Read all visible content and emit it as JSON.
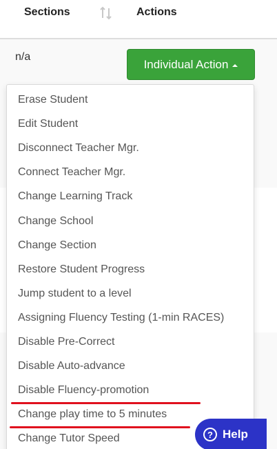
{
  "table": {
    "headers": {
      "sections": "Sections",
      "actions": "Actions"
    },
    "row": {
      "section_value": "n/a"
    }
  },
  "action_button": {
    "label": "Individual Action",
    "color": "#3aa33a",
    "state": "expanded"
  },
  "dropdown": {
    "items": [
      "Erase Student",
      "Edit Student",
      "Disconnect Teacher Mgr.",
      "Connect Teacher Mgr.",
      "Change Learning Track",
      "Change School",
      "Change Section",
      "Restore Student Progress",
      "Jump student to a level",
      "Assigning Fluency Testing (1-min RACES)",
      "Disable Pre-Correct",
      "Disable Auto-advance",
      "Disable Fluency-promotion",
      "Change play time to 5 minutes",
      "Change Tutor Speed"
    ],
    "highlighted_items": [
      "Disable Fluency-promotion",
      "Change play time to 5 minutes"
    ],
    "highlight_color": "#e0101e"
  },
  "help": {
    "label": "Help",
    "icon": "question-circle-icon",
    "color": "#2c33c7"
  }
}
